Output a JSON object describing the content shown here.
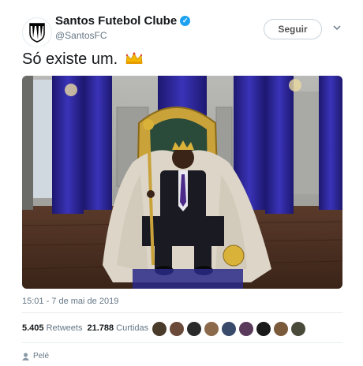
{
  "account": {
    "name": "Santos Futebol Clube",
    "handle": "@SantosFC",
    "verified_icon": "check-icon"
  },
  "follow_label": "Seguir",
  "tweet_text": "Só existe um.",
  "emoji": "crown-icon",
  "timestamp": "15:01 - 7 de mai de 2019",
  "stats": {
    "retweets_count": "5.405",
    "retweets_label": "Retweets",
    "likes_count": "21.788",
    "likes_label": "Curtidas"
  },
  "liker_count": 9,
  "footer_name": "Pelé",
  "colors": {
    "accent": "#1da1f2",
    "crown": "#f5b800"
  }
}
